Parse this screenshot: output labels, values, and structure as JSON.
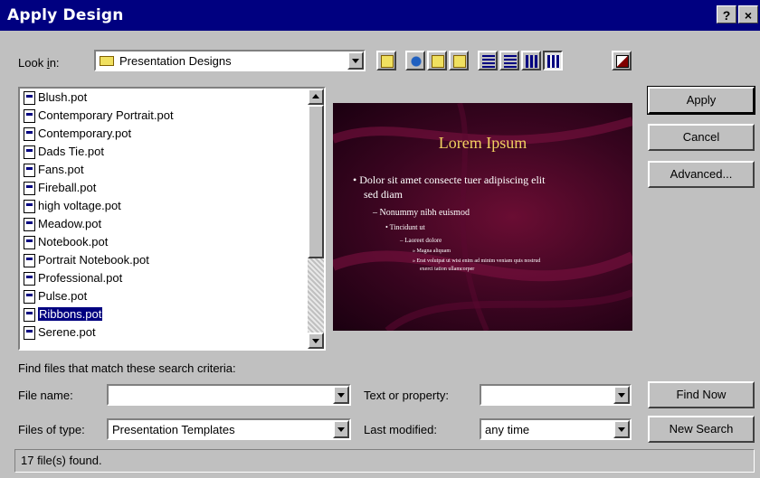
{
  "window": {
    "title": "Apply Design",
    "help_label": "?",
    "close_label": "×"
  },
  "lookin": {
    "label_pre": "Look ",
    "label_u": "i",
    "label_post": "n:",
    "value": "Presentation Designs"
  },
  "files": [
    {
      "name": "Blush.pot"
    },
    {
      "name": "Contemporary Portrait.pot"
    },
    {
      "name": "Contemporary.pot"
    },
    {
      "name": "Dads Tie.pot"
    },
    {
      "name": "Fans.pot"
    },
    {
      "name": "Fireball.pot"
    },
    {
      "name": "high voltage.pot"
    },
    {
      "name": "Meadow.pot"
    },
    {
      "name": "Notebook.pot"
    },
    {
      "name": "Portrait Notebook.pot"
    },
    {
      "name": "Professional.pot"
    },
    {
      "name": "Pulse.pot"
    },
    {
      "name": "Ribbons.pot",
      "selected": true
    },
    {
      "name": "Serene.pot"
    }
  ],
  "preview": {
    "title": "Lorem Ipsum",
    "bullet1a": "• Dolor sit amet consecte tuer adipiscing elit",
    "bullet1b": "sed diam",
    "bullet2": "– Nonummy nibh euismod",
    "bullet3": "• Tincidunt ut",
    "bullet4": "– Laoreet dolore",
    "bullet5": "» Magna aliquam",
    "bullet6a": "» Erat volutpat ut wisi enim ad minim veniam quis nostrud",
    "bullet6b": "exerci tation ullamcorper"
  },
  "buttons": {
    "apply": "Apply",
    "cancel": "Cancel",
    "advanced": "Advanced...",
    "find_now": "Find Now",
    "new_search": "New Search"
  },
  "search": {
    "heading": "Find files that match these search criteria:",
    "file_name_label": "File name:",
    "file_name_value": "",
    "files_type_label": "Files of type:",
    "files_type_value": "Presentation Templates",
    "text_prop_label": "Text or property:",
    "text_prop_value": "",
    "last_mod_label": "Last modified:",
    "last_mod_value": "any time"
  },
  "status": "17 file(s) found.",
  "colors": {
    "titlebar": "#000080",
    "preview_bg": "#4a0828",
    "preview_title": "#f0d060"
  },
  "icons": [
    "folder-icon",
    "up-folder-icon",
    "web-search-icon",
    "favorites-icon",
    "add-favorites-icon",
    "list-view-icon",
    "details-view-icon",
    "properties-view-icon",
    "preview-view-icon",
    "commands-icon"
  ]
}
